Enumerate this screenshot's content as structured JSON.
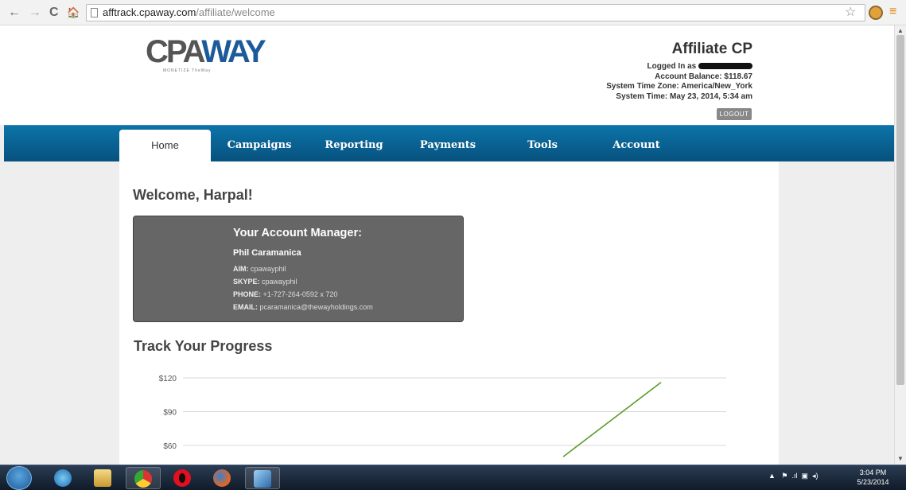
{
  "browser": {
    "url_host": "afftrack.cpaway.com",
    "url_path": "/affiliate/welcome",
    "back": "←",
    "forward": "→",
    "reload": "C",
    "home": "🏠",
    "star": "☆",
    "menu": "≡"
  },
  "header": {
    "logo_cpa": "CPA",
    "logo_way": "WAY",
    "logo_tagline": "MONETIZE TheWay",
    "title": "Affiliate CP",
    "logged_in_label": "Logged In as",
    "balance": "Account Balance: $118.67",
    "timezone": "System Time Zone: America/New_York",
    "system_time": "System Time: May 23, 2014, 5:34 am",
    "logout": "LOGOUT"
  },
  "nav": {
    "items": [
      {
        "label": "Home",
        "active": true
      },
      {
        "label": "Campaigns",
        "active": false
      },
      {
        "label": "Reporting",
        "active": false
      },
      {
        "label": "Payments",
        "active": false
      },
      {
        "label": "Tools",
        "active": false
      },
      {
        "label": "Account",
        "active": false
      }
    ]
  },
  "main": {
    "welcome": "Welcome, Harpal!",
    "manager": {
      "heading": "Your Account Manager:",
      "name": "Phil Caramanica",
      "aim_label": "AIM:",
      "aim": "cpawayphil",
      "skype_label": "SKYPE:",
      "skype": "cpawayphil",
      "phone_label": "PHONE:",
      "phone": "+1-727-264-0592 x 720",
      "email_label": "EMAIL:",
      "email": "pcaramanica@thewayholdings.com"
    },
    "progress_title": "Track Your Progress"
  },
  "chart_data": {
    "type": "line",
    "ticks": [
      {
        "value": 120,
        "label": "$120"
      },
      {
        "value": 90,
        "label": "$90"
      },
      {
        "value": 60,
        "label": "$60"
      }
    ],
    "ylim": [
      55,
      125
    ],
    "xlim": [
      0,
      1
    ],
    "series": [
      {
        "color": "#5a9a2a",
        "points": [
          [
            0.7,
            50
          ],
          [
            0.88,
            116
          ]
        ]
      }
    ],
    "grid": true
  },
  "taskbar": {
    "time": "3:04 PM",
    "date": "5/23/2014",
    "apps": [
      "ie-icon",
      "file-explorer-icon",
      "chrome-icon",
      "opera-icon",
      "firefox-icon",
      "app-icon"
    ]
  }
}
